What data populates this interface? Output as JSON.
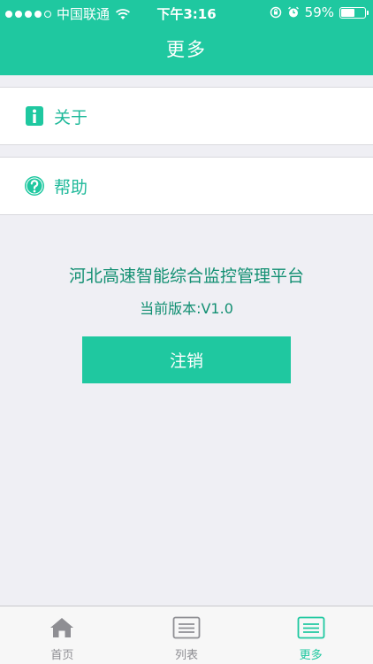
{
  "status_bar": {
    "carrier": "中国联通",
    "time": "下午3:16",
    "battery": "59%",
    "battery_level": 0.59
  },
  "nav": {
    "title": "更多"
  },
  "menu": {
    "items": [
      {
        "label": "关于",
        "icon": "info-icon"
      },
      {
        "label": "帮助",
        "icon": "question-circle-icon"
      }
    ]
  },
  "info": {
    "app_name": "河北高速智能综合监控管理平台",
    "version": "当前版本:V1.0"
  },
  "logout": {
    "label": "注销"
  },
  "tabs": [
    {
      "label": "首页",
      "icon": "home-icon",
      "active": false
    },
    {
      "label": "列表",
      "icon": "list-icon",
      "active": false
    },
    {
      "label": "更多",
      "icon": "more-list-icon",
      "active": true
    }
  ],
  "colors": {
    "accent": "#1fc8a0",
    "text_accent": "#128f72",
    "background": "#efeff4",
    "tab_inactive": "#8e8e93"
  }
}
